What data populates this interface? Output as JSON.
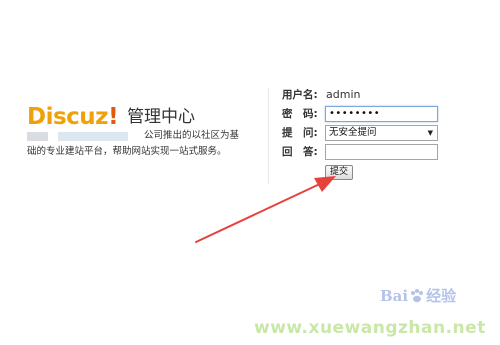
{
  "brand": {
    "logo_text": "Discuz",
    "logo_exclaim": "!",
    "title": "管理中心",
    "description_line1": "公司推出的以社区为基",
    "description_line2": "础的专业建站平台，帮助网站实现一站式服务。"
  },
  "login_form": {
    "username_label": "用户名:",
    "username_value": "admin",
    "password_label": "密　码:",
    "password_value": "••••••••",
    "question_label": "提　问:",
    "question_selected": "无安全提问",
    "answer_label": "回　答:",
    "answer_value": "",
    "submit_label": "提交"
  },
  "watermark": {
    "baidu_text_left": "Bai",
    "baidu_text_right": "经验",
    "site": "www.xuewangzhan.net"
  },
  "colors": {
    "logo_orange": "#f0a10a",
    "logo_exclaim": "#e25a0b",
    "annotation_arrow": "#e8403a",
    "focus_border": "#7aa7d6"
  }
}
